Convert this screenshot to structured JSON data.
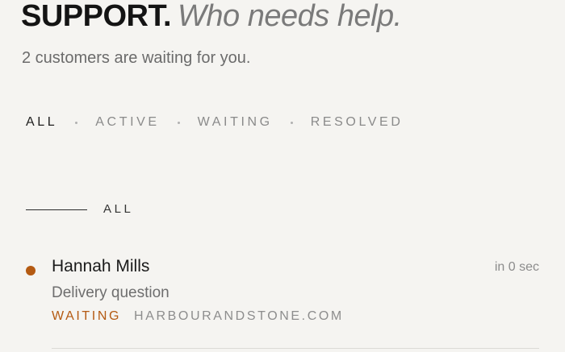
{
  "header": {
    "title_strong": "SUPPORT.",
    "title_italic": "Who needs help.",
    "subtitle": "2 customers are waiting for you."
  },
  "filters": {
    "tabs": [
      {
        "label": "ALL",
        "active": true
      },
      {
        "label": "ACTIVE",
        "active": false
      },
      {
        "label": "WAITING",
        "active": false
      },
      {
        "label": "RESOLVED",
        "active": false
      }
    ]
  },
  "section": {
    "label": "ALL"
  },
  "tickets": [
    {
      "name": "Hannah Mills",
      "time": "in 0 sec",
      "subject": "Delivery question",
      "status": "WAITING",
      "domain": "HARBOURANDSTONE.COM"
    }
  ],
  "colors": {
    "accent": "#b45a12",
    "background": "#f5f4f1"
  }
}
